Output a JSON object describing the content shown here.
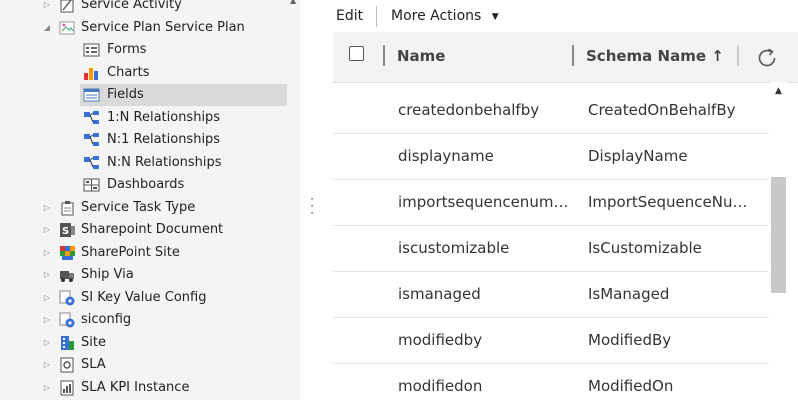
{
  "tree": {
    "items": [
      {
        "label": "Service Activity",
        "icon": "service-activity-icon",
        "level": 0,
        "expanded": false
      },
      {
        "label": "Service Plan Service Plan",
        "icon": "broken-image-icon",
        "level": 0,
        "expanded": true
      },
      {
        "label": "Forms",
        "icon": "forms-icon",
        "level": 1
      },
      {
        "label": "Charts",
        "icon": "charts-icon",
        "level": 1
      },
      {
        "label": "Fields",
        "icon": "fields-icon",
        "level": 1,
        "selected": true
      },
      {
        "label": "1:N Relationships",
        "icon": "one-to-many-relationship-icon",
        "level": 1
      },
      {
        "label": "N:1 Relationships",
        "icon": "many-to-one-relationship-icon",
        "level": 1
      },
      {
        "label": "N:N Relationships",
        "icon": "many-to-many-relationship-icon",
        "level": 1
      },
      {
        "label": "Dashboards",
        "icon": "dashboards-icon",
        "level": 1
      },
      {
        "label": "Service Task Type",
        "icon": "clipboard-icon",
        "level": 0,
        "expanded": false
      },
      {
        "label": "Sharepoint Document",
        "icon": "sharepoint-document-icon",
        "level": 0,
        "expanded": false
      },
      {
        "label": "SharePoint Site",
        "icon": "sharepoint-site-icon",
        "level": 0,
        "expanded": false
      },
      {
        "label": "Ship Via",
        "icon": "truck-icon",
        "level": 0,
        "expanded": false
      },
      {
        "label": "SI Key Value Config",
        "icon": "config-gear-icon",
        "level": 0,
        "expanded": false
      },
      {
        "label": "siconfig",
        "icon": "config-gear-icon",
        "level": 0,
        "expanded": false
      },
      {
        "label": "Site",
        "icon": "site-building-icon",
        "level": 0,
        "expanded": false
      },
      {
        "label": "SLA",
        "icon": "sla-icon",
        "level": 0,
        "expanded": false
      },
      {
        "label": "SLA KPI Instance",
        "icon": "sla-kpi-icon",
        "level": 0,
        "expanded": false
      }
    ]
  },
  "toolbar": {
    "edit_label": "Edit",
    "more_actions_label": "More Actions"
  },
  "grid": {
    "columns": [
      {
        "label": "Name"
      },
      {
        "label": "Schema Name ↑"
      }
    ],
    "rows": [
      {
        "name": "createdonbehalfby",
        "schema": "CreatedOnBehalfBy"
      },
      {
        "name": "displayname",
        "schema": "DisplayName"
      },
      {
        "name": "importsequencenumber",
        "schema": "ImportSequenceNumber"
      },
      {
        "name": "iscustomizable",
        "schema": "IsCustomizable"
      },
      {
        "name": "ismanaged",
        "schema": "IsManaged"
      },
      {
        "name": "modifiedby",
        "schema": "ModifiedBy"
      },
      {
        "name": "modifiedon",
        "schema": "ModifiedOn"
      }
    ]
  },
  "colors": {
    "tree_bg": "#f4f4f4",
    "selected_bg": "#dadada",
    "header_bg": "#f3f3f3",
    "scroll_thumb": "#c8c8c8"
  }
}
